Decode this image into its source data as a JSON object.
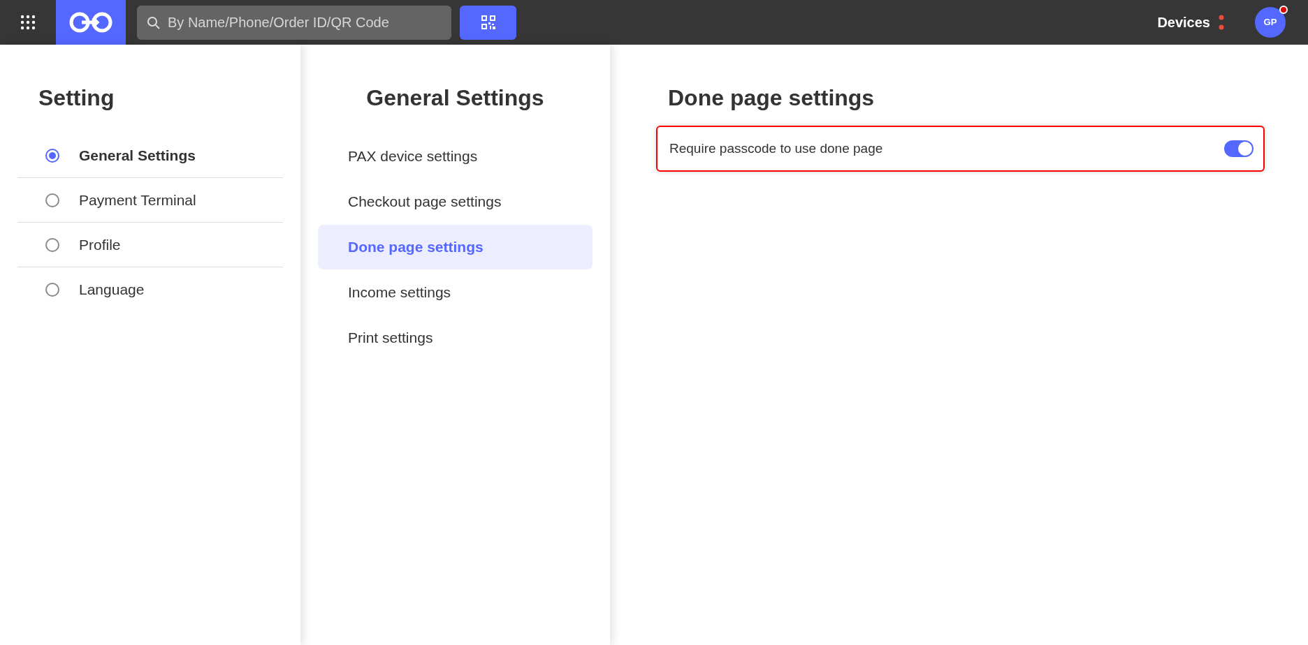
{
  "top_bar": {
    "search": {
      "placeholder": "By Name/Phone/Order ID/QR Code"
    },
    "devices_label": "Devices",
    "avatar": {
      "initials": "GP",
      "notification": true
    }
  },
  "setting_menu": {
    "title": "Setting",
    "items": [
      {
        "label": "General Settings",
        "selected": true
      },
      {
        "label": "Payment Terminal",
        "selected": false
      },
      {
        "label": "Profile",
        "selected": false
      },
      {
        "label": "Language",
        "selected": false
      }
    ]
  },
  "general_settings": {
    "title": "General Settings",
    "items": [
      {
        "label": "PAX device settings",
        "selected": false
      },
      {
        "label": "Checkout page settings",
        "selected": false
      },
      {
        "label": "Done page settings",
        "selected": true
      },
      {
        "label": "Income settings",
        "selected": false
      },
      {
        "label": "Print settings",
        "selected": false
      }
    ]
  },
  "done_page_settings": {
    "title": "Done page settings",
    "options": [
      {
        "label": "Require passcode to use done page",
        "on": true,
        "highlighted": true
      }
    ]
  }
}
